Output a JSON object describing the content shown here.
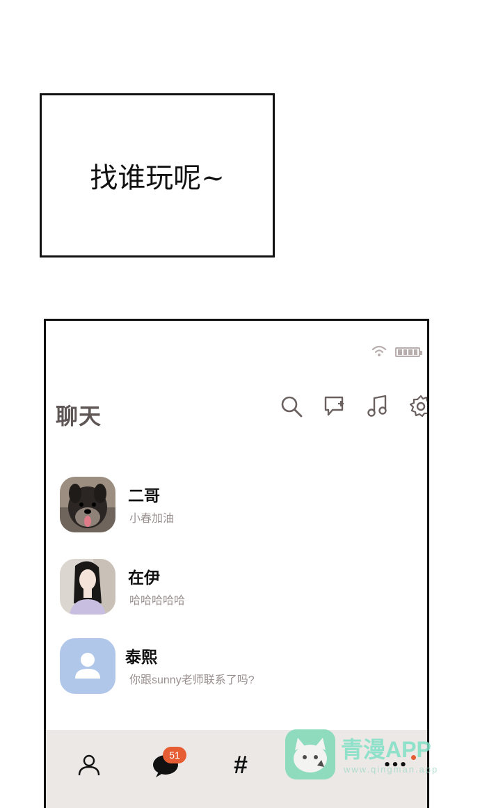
{
  "caption": {
    "text": "找谁玩呢~"
  },
  "app": {
    "title": "聊天",
    "icons": [
      "search-icon",
      "new-chat-icon",
      "music-icon",
      "settings-icon"
    ],
    "status_icons": [
      "wifi-icon",
      "battery-icon"
    ]
  },
  "chats": [
    {
      "name": "二哥",
      "preview": "小春加油",
      "avatar": "dog-photo"
    },
    {
      "name": "在伊",
      "preview": "哈哈哈哈哈",
      "avatar": "girl-photo"
    },
    {
      "name": "泰熙",
      "preview": "你跟sunny老师联系了吗?",
      "avatar": "default-user"
    }
  ],
  "tabbar": {
    "tabs": [
      "profile-icon",
      "chat-icon",
      "hashtag-icon",
      "more-icon"
    ],
    "hashtag_label": "#",
    "more_label": "•••",
    "chat_badge": "51"
  },
  "watermark": {
    "title": "青漫APP",
    "url": "www.qingman.app"
  },
  "colors": {
    "accent": "#e65c33",
    "title": "#5f5656",
    "preview": "#9a9090",
    "tabbar_bg": "#ece8e6",
    "avatar_default": "#b0c7ea"
  }
}
